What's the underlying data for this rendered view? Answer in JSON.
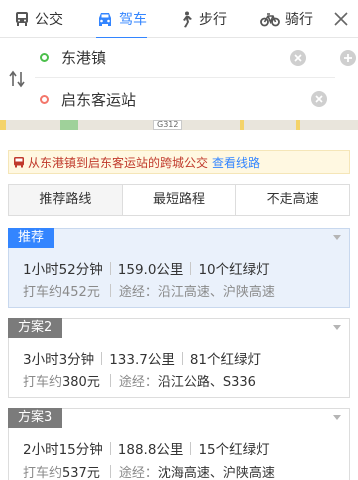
{
  "modes": [
    {
      "label": "公交",
      "icon": "bus-icon"
    },
    {
      "label": "驾车",
      "icon": "car-icon"
    },
    {
      "label": "步行",
      "icon": "walk-icon"
    },
    {
      "label": "骑行",
      "icon": "bike-icon"
    }
  ],
  "active_mode": "驾车",
  "route": {
    "start": "东港镇",
    "end": "启东客运站"
  },
  "map": {
    "road_label": "G312"
  },
  "notice": {
    "text": "从东港镇到启东客运站的跨城公交",
    "link": "查看线路"
  },
  "preferences": [
    "推荐路线",
    "最短路程",
    "不走高速"
  ],
  "plans": [
    {
      "badge": "推荐",
      "duration": "1小时52分钟",
      "distance": "159.0公里",
      "lights": "10个红绿灯",
      "taxi_label": "打车约",
      "taxi_fare": "452元",
      "via_label": "途经：",
      "via": "沿江高速、沪陕高速"
    },
    {
      "badge": "方案2",
      "duration": "3小时3分钟",
      "distance": "133.7公里",
      "lights": "81个红绿灯",
      "taxi_label": "打车约",
      "taxi_fare": "380元",
      "via_label": "途经：",
      "via": "沿江公路、S336"
    },
    {
      "badge": "方案3",
      "duration": "2小时15分钟",
      "distance": "188.8公里",
      "lights": "15个红绿灯",
      "taxi_label": "打车约",
      "taxi_fare": "537元",
      "via_label": "途经：",
      "via": "沈海高速、沪陕高速"
    }
  ],
  "colors": {
    "accent": "#3385ff",
    "start_dot": "#4bbf4b",
    "end_dot": "#f3766a",
    "notice_text": "#c0392b"
  }
}
